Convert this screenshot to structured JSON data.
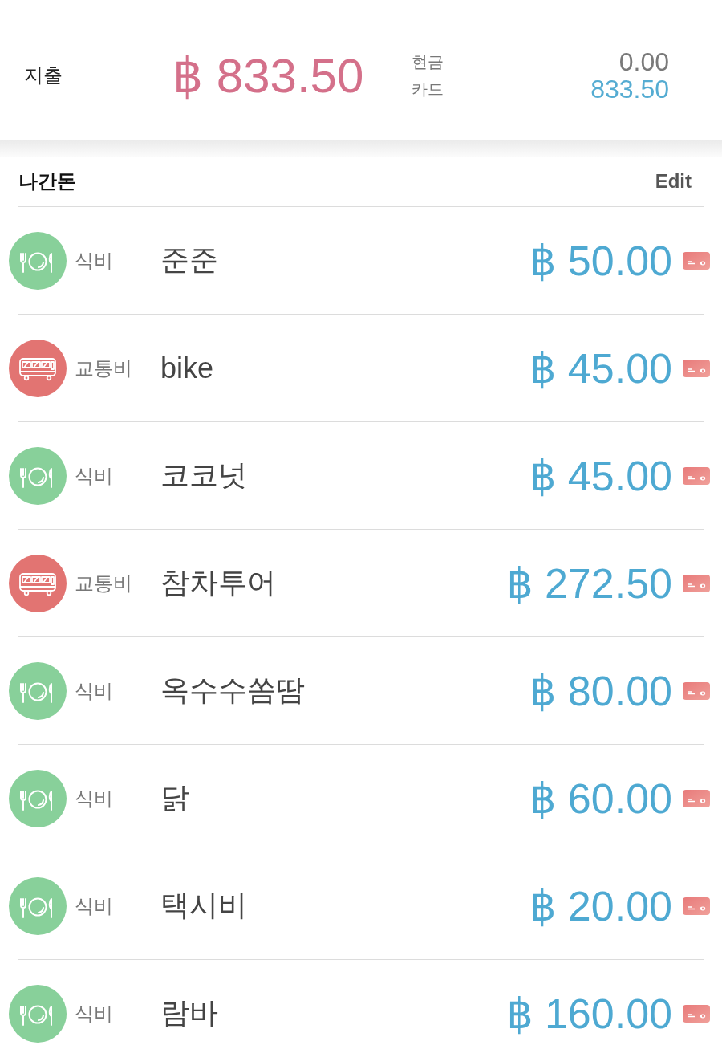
{
  "summary": {
    "label": "지출",
    "total": "฿ 833.50",
    "breakdown": [
      {
        "kind": "cash",
        "label": "현금",
        "value": "0.00"
      },
      {
        "kind": "card",
        "label": "카드",
        "value": "833.50"
      }
    ]
  },
  "section": {
    "title": "나간돈",
    "action": "Edit"
  },
  "rows": [
    {
      "category": {
        "kind": "food",
        "label": "식비",
        "color": "#88d09a"
      },
      "name": "준준",
      "amount": "฿ 50.00",
      "payment": {
        "kind": "card"
      }
    },
    {
      "category": {
        "kind": "transport",
        "label": "교통비",
        "color": "#e27472"
      },
      "name": "bike",
      "amount": "฿ 45.00",
      "payment": {
        "kind": "card"
      }
    },
    {
      "category": {
        "kind": "food",
        "label": "식비",
        "color": "#88d09a"
      },
      "name": "코코넛",
      "amount": "฿ 45.00",
      "payment": {
        "kind": "card"
      }
    },
    {
      "category": {
        "kind": "transport",
        "label": "교통비",
        "color": "#e27472"
      },
      "name": "참차투어",
      "amount": "฿ 272.50",
      "payment": {
        "kind": "card"
      }
    },
    {
      "category": {
        "kind": "food",
        "label": "식비",
        "color": "#88d09a"
      },
      "name": "옥수수쏨땀",
      "amount": "฿ 80.00",
      "payment": {
        "kind": "card"
      }
    },
    {
      "category": {
        "kind": "food",
        "label": "식비",
        "color": "#88d09a"
      },
      "name": "닭",
      "amount": "฿ 60.00",
      "payment": {
        "kind": "card"
      }
    },
    {
      "category": {
        "kind": "food",
        "label": "식비",
        "color": "#88d09a"
      },
      "name": "택시비",
      "amount": "฿ 20.00",
      "payment": {
        "kind": "card"
      }
    },
    {
      "category": {
        "kind": "food",
        "label": "식비",
        "color": "#88d09a"
      },
      "name": "람바",
      "amount": "฿ 160.00",
      "payment": {
        "kind": "card"
      }
    }
  ]
}
